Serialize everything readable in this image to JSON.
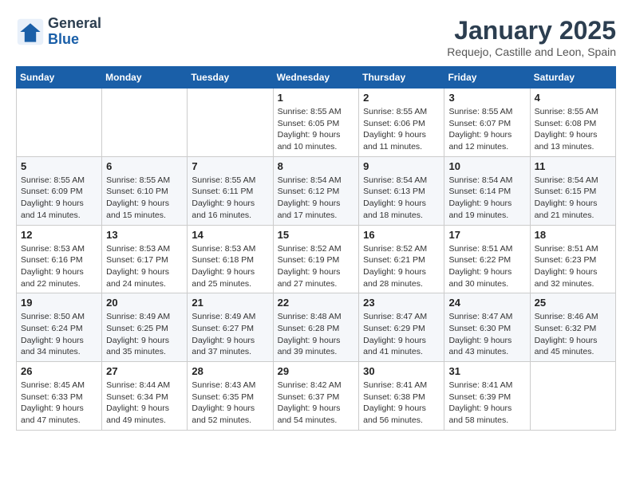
{
  "logo": {
    "line1": "General",
    "line2": "Blue"
  },
  "title": "January 2025",
  "subtitle": "Requejo, Castille and Leon, Spain",
  "weekdays": [
    "Sunday",
    "Monday",
    "Tuesday",
    "Wednesday",
    "Thursday",
    "Friday",
    "Saturday"
  ],
  "weeks": [
    [
      {
        "day": "",
        "info": ""
      },
      {
        "day": "",
        "info": ""
      },
      {
        "day": "",
        "info": ""
      },
      {
        "day": "1",
        "info": "Sunrise: 8:55 AM\nSunset: 6:05 PM\nDaylight: 9 hours and 10 minutes."
      },
      {
        "day": "2",
        "info": "Sunrise: 8:55 AM\nSunset: 6:06 PM\nDaylight: 9 hours and 11 minutes."
      },
      {
        "day": "3",
        "info": "Sunrise: 8:55 AM\nSunset: 6:07 PM\nDaylight: 9 hours and 12 minutes."
      },
      {
        "day": "4",
        "info": "Sunrise: 8:55 AM\nSunset: 6:08 PM\nDaylight: 9 hours and 13 minutes."
      }
    ],
    [
      {
        "day": "5",
        "info": "Sunrise: 8:55 AM\nSunset: 6:09 PM\nDaylight: 9 hours and 14 minutes."
      },
      {
        "day": "6",
        "info": "Sunrise: 8:55 AM\nSunset: 6:10 PM\nDaylight: 9 hours and 15 minutes."
      },
      {
        "day": "7",
        "info": "Sunrise: 8:55 AM\nSunset: 6:11 PM\nDaylight: 9 hours and 16 minutes."
      },
      {
        "day": "8",
        "info": "Sunrise: 8:54 AM\nSunset: 6:12 PM\nDaylight: 9 hours and 17 minutes."
      },
      {
        "day": "9",
        "info": "Sunrise: 8:54 AM\nSunset: 6:13 PM\nDaylight: 9 hours and 18 minutes."
      },
      {
        "day": "10",
        "info": "Sunrise: 8:54 AM\nSunset: 6:14 PM\nDaylight: 9 hours and 19 minutes."
      },
      {
        "day": "11",
        "info": "Sunrise: 8:54 AM\nSunset: 6:15 PM\nDaylight: 9 hours and 21 minutes."
      }
    ],
    [
      {
        "day": "12",
        "info": "Sunrise: 8:53 AM\nSunset: 6:16 PM\nDaylight: 9 hours and 22 minutes."
      },
      {
        "day": "13",
        "info": "Sunrise: 8:53 AM\nSunset: 6:17 PM\nDaylight: 9 hours and 24 minutes."
      },
      {
        "day": "14",
        "info": "Sunrise: 8:53 AM\nSunset: 6:18 PM\nDaylight: 9 hours and 25 minutes."
      },
      {
        "day": "15",
        "info": "Sunrise: 8:52 AM\nSunset: 6:19 PM\nDaylight: 9 hours and 27 minutes."
      },
      {
        "day": "16",
        "info": "Sunrise: 8:52 AM\nSunset: 6:21 PM\nDaylight: 9 hours and 28 minutes."
      },
      {
        "day": "17",
        "info": "Sunrise: 8:51 AM\nSunset: 6:22 PM\nDaylight: 9 hours and 30 minutes."
      },
      {
        "day": "18",
        "info": "Sunrise: 8:51 AM\nSunset: 6:23 PM\nDaylight: 9 hours and 32 minutes."
      }
    ],
    [
      {
        "day": "19",
        "info": "Sunrise: 8:50 AM\nSunset: 6:24 PM\nDaylight: 9 hours and 34 minutes."
      },
      {
        "day": "20",
        "info": "Sunrise: 8:49 AM\nSunset: 6:25 PM\nDaylight: 9 hours and 35 minutes."
      },
      {
        "day": "21",
        "info": "Sunrise: 8:49 AM\nSunset: 6:27 PM\nDaylight: 9 hours and 37 minutes."
      },
      {
        "day": "22",
        "info": "Sunrise: 8:48 AM\nSunset: 6:28 PM\nDaylight: 9 hours and 39 minutes."
      },
      {
        "day": "23",
        "info": "Sunrise: 8:47 AM\nSunset: 6:29 PM\nDaylight: 9 hours and 41 minutes."
      },
      {
        "day": "24",
        "info": "Sunrise: 8:47 AM\nSunset: 6:30 PM\nDaylight: 9 hours and 43 minutes."
      },
      {
        "day": "25",
        "info": "Sunrise: 8:46 AM\nSunset: 6:32 PM\nDaylight: 9 hours and 45 minutes."
      }
    ],
    [
      {
        "day": "26",
        "info": "Sunrise: 8:45 AM\nSunset: 6:33 PM\nDaylight: 9 hours and 47 minutes."
      },
      {
        "day": "27",
        "info": "Sunrise: 8:44 AM\nSunset: 6:34 PM\nDaylight: 9 hours and 49 minutes."
      },
      {
        "day": "28",
        "info": "Sunrise: 8:43 AM\nSunset: 6:35 PM\nDaylight: 9 hours and 52 minutes."
      },
      {
        "day": "29",
        "info": "Sunrise: 8:42 AM\nSunset: 6:37 PM\nDaylight: 9 hours and 54 minutes."
      },
      {
        "day": "30",
        "info": "Sunrise: 8:41 AM\nSunset: 6:38 PM\nDaylight: 9 hours and 56 minutes."
      },
      {
        "day": "31",
        "info": "Sunrise: 8:41 AM\nSunset: 6:39 PM\nDaylight: 9 hours and 58 minutes."
      },
      {
        "day": "",
        "info": ""
      }
    ]
  ]
}
